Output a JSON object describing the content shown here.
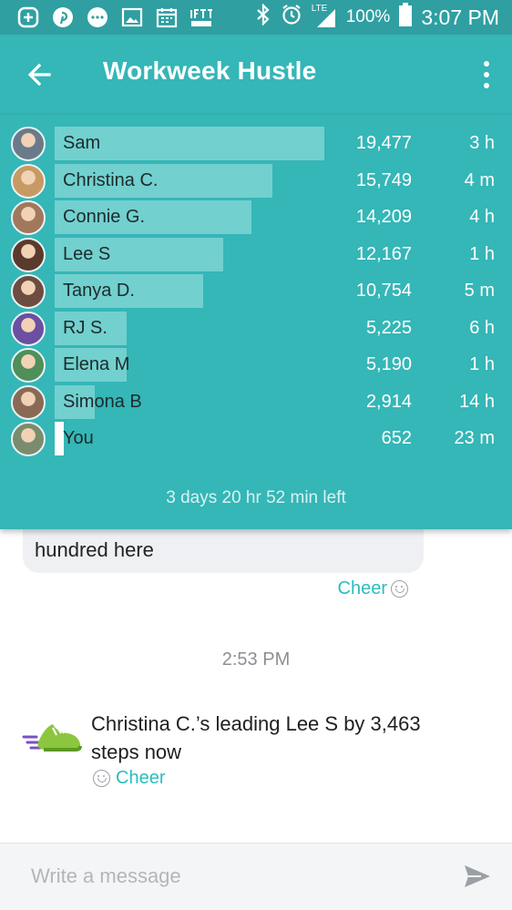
{
  "status_bar": {
    "battery": "100%",
    "time": "3:07 PM",
    "network": "LTE",
    "icons": [
      "plus-icon",
      "pinterest-icon",
      "chat-bubble-icon",
      "image-icon",
      "calendar-icon",
      "ifttt-icon",
      "bluetooth-icon",
      "alarm-icon",
      "signal-icon",
      "battery-icon"
    ]
  },
  "app_bar": {
    "title": "Workweek Hustle"
  },
  "leaderboard": {
    "rows": [
      {
        "name": "Sam",
        "steps": "19,477",
        "ago": "3 h",
        "fraction": 1.0,
        "is_you": false,
        "avatar_color": "#6b7a8a"
      },
      {
        "name": "Christina C.",
        "steps": "15,749",
        "ago": "4 m",
        "fraction": 0.809,
        "is_you": false,
        "avatar_color": "#c89a63"
      },
      {
        "name": "Connie G.",
        "steps": "14,209",
        "ago": "4 h",
        "fraction": 0.73,
        "is_you": false,
        "avatar_color": "#a1785c"
      },
      {
        "name": "Lee S",
        "steps": "12,167",
        "ago": "1 h",
        "fraction": 0.625,
        "is_you": false,
        "avatar_color": "#5b3a2e"
      },
      {
        "name": "Tanya D.",
        "steps": "10,754",
        "ago": "5 m",
        "fraction": 0.552,
        "is_you": false,
        "avatar_color": "#6d4c41"
      },
      {
        "name": "RJ S.",
        "steps": "5,225",
        "ago": "6 h",
        "fraction": 0.268,
        "is_you": false,
        "avatar_color": "#6a4fa3"
      },
      {
        "name": "Elena M",
        "steps": "5,190",
        "ago": "1 h",
        "fraction": 0.266,
        "is_you": false,
        "avatar_color": "#4e8f5a"
      },
      {
        "name": "Simona B",
        "steps": "2,914",
        "ago": "14 h",
        "fraction": 0.15,
        "is_you": false,
        "avatar_color": "#8a6a55"
      },
      {
        "name": "You",
        "steps": "652",
        "ago": "23 m",
        "fraction": 0.033,
        "is_you": true,
        "avatar_color": "#7a8c6e"
      }
    ],
    "time_left": "3 days 20 hr 52 min left"
  },
  "chat": {
    "bubble_text": "hundred here",
    "cheer_label": "Cheer",
    "timestamp": "2:53 PM",
    "system_message": "Christina C.’s leading Lee S by 3,463 steps now",
    "system_cheer_label": "Cheer"
  },
  "composer": {
    "placeholder": "Write a message"
  },
  "colors": {
    "header": "#35b6b7",
    "status_bar": "#2f9fa1",
    "bar": "#72d0cf",
    "accent": "#2bbcbf",
    "shoe": "#8cc63f"
  }
}
